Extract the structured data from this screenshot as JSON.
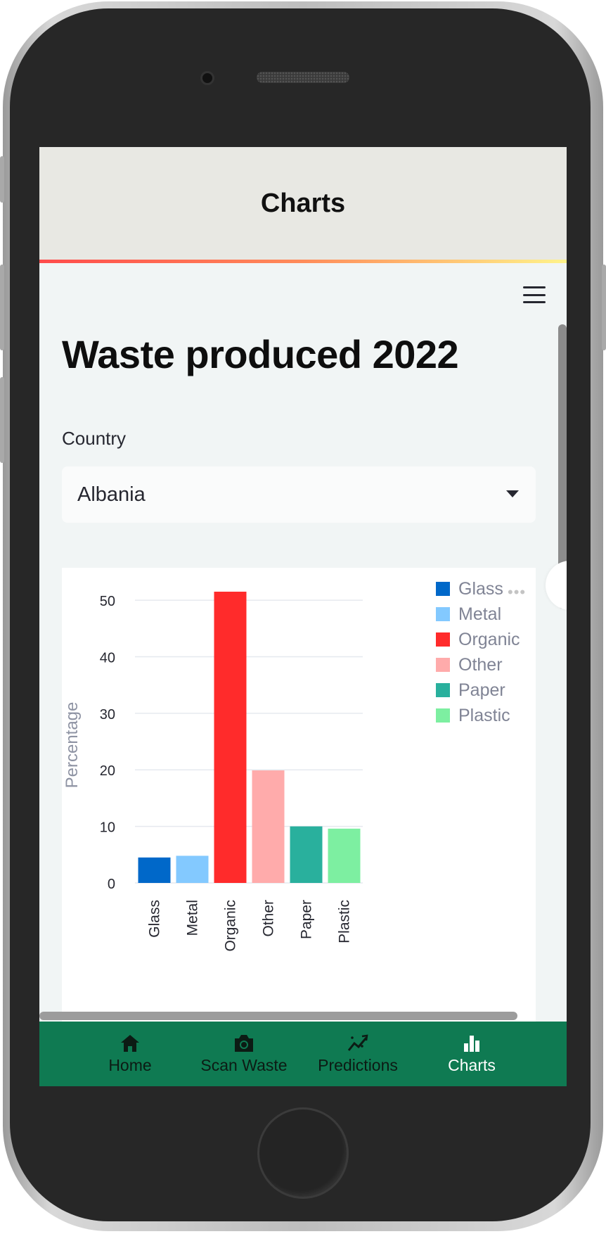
{
  "app": {
    "header_title": "Charts"
  },
  "page": {
    "title": "Waste produced 2022",
    "country_label": "Country",
    "country_value": "Albania"
  },
  "nav": {
    "items": [
      {
        "label": "Home",
        "icon": "home-icon",
        "active": false
      },
      {
        "label": "Scan Waste",
        "icon": "camera-icon",
        "active": false
      },
      {
        "label": "Predictions",
        "icon": "trend-icon",
        "active": false
      },
      {
        "label": "Charts",
        "icon": "bar-chart-icon",
        "active": true
      }
    ]
  },
  "colors": {
    "header_bg": "#e8e8e3",
    "nav_bg": "#0f7a52",
    "screen_bg": "#f1f5f5"
  },
  "chart_data": {
    "type": "bar",
    "categories": [
      "Glass",
      "Metal",
      "Organic",
      "Other",
      "Paper",
      "Plastic"
    ],
    "values": [
      4.5,
      4.8,
      51.5,
      19.9,
      10.0,
      9.6
    ],
    "colors": [
      "#0068c9",
      "#83c9ff",
      "#ff2b2b",
      "#ffabab",
      "#29b09d",
      "#7defa1"
    ],
    "ylabel": "Percentage",
    "xlabel": "",
    "ylim": [
      0,
      52
    ],
    "yticks": [
      0,
      10,
      20,
      30,
      40,
      50
    ],
    "grid": true,
    "legend": {
      "position": "top-right",
      "entries": [
        "Glass",
        "Metal",
        "Organic",
        "Other",
        "Paper",
        "Plastic"
      ]
    }
  }
}
